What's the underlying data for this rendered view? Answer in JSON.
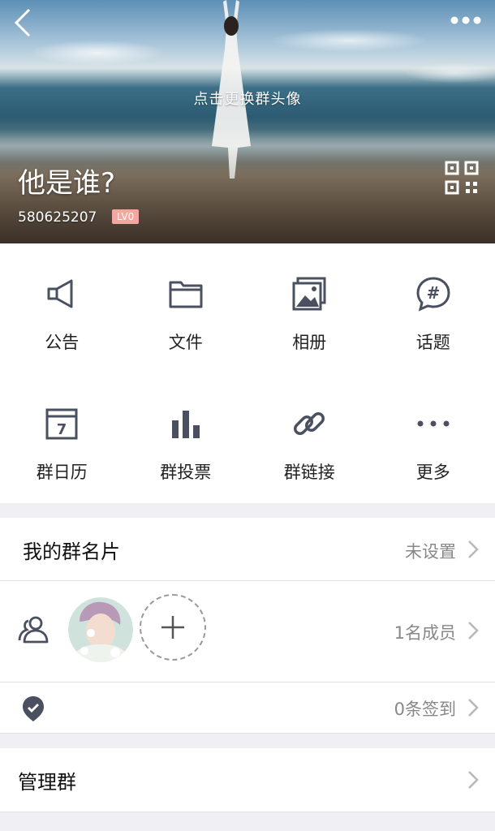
{
  "header": {
    "change_avatar_hint": "点击更换群头像",
    "group_name": "他是谁?",
    "group_id": "580625207",
    "level_badge": "LV0"
  },
  "features": [
    {
      "label": "公告",
      "icon": "megaphone-icon"
    },
    {
      "label": "文件",
      "icon": "folder-icon"
    },
    {
      "label": "相册",
      "icon": "photo-album-icon"
    },
    {
      "label": "话题",
      "icon": "hashtag-chat-icon"
    },
    {
      "label": "群日历",
      "icon": "calendar-icon"
    },
    {
      "label": "群投票",
      "icon": "bar-chart-icon"
    },
    {
      "label": "群链接",
      "icon": "link-icon"
    },
    {
      "label": "更多",
      "icon": "more-dots-icon"
    }
  ],
  "rows": {
    "my_card": {
      "title": "我的群名片",
      "value": "未设置"
    },
    "members": {
      "value": "1名成员"
    },
    "checkin": {
      "value": "0条签到"
    },
    "manage": {
      "title": "管理群"
    }
  },
  "colors": {
    "icon": "#4a5060",
    "badge": "#f4a6a0",
    "chevron": "#b8b8b8"
  }
}
